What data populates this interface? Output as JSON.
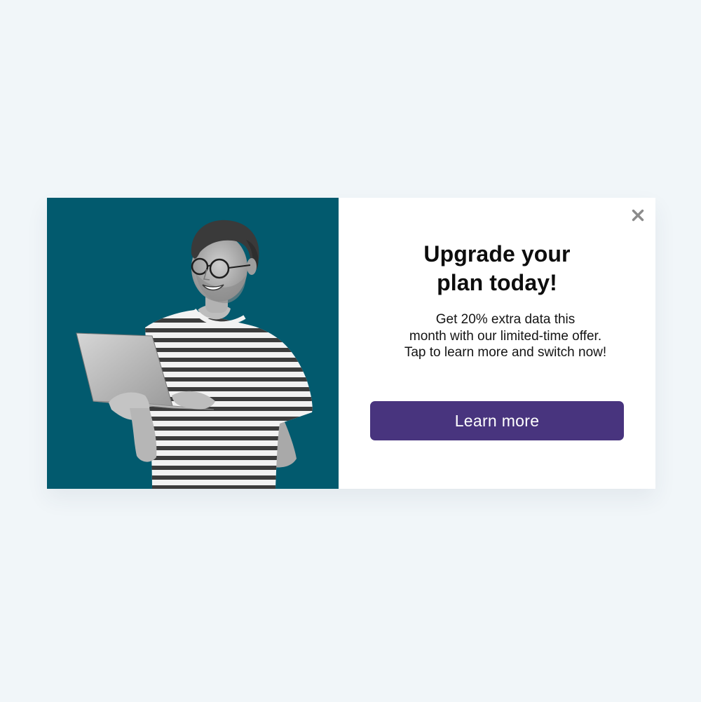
{
  "modal": {
    "title": "Upgrade your\nplan today!",
    "body": "Get 20% extra data this\nmonth with our limited-time offer.\nTap to learn more and switch now!",
    "cta_label": "Learn more",
    "close_icon": "close-icon",
    "image": "smiling man holding laptop"
  },
  "colors": {
    "page_background": "#f1f6f9",
    "hero_background": "#025a6e",
    "cta_background": "#48347e",
    "close_icon": "#8b8b8b"
  }
}
